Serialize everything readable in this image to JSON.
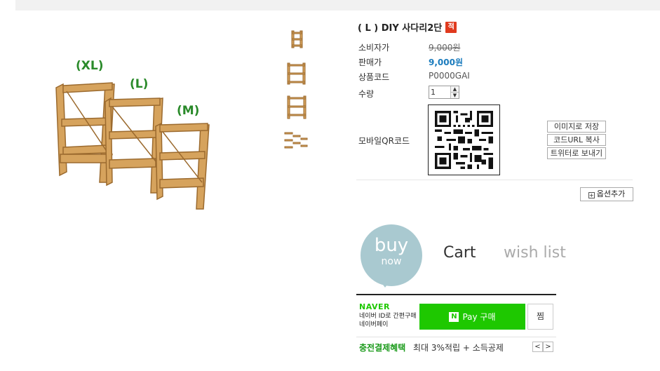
{
  "product": {
    "title": "( L ) DIY 사다리2단",
    "badge": "적",
    "size_labels": [
      "(XL)",
      "(L)",
      "(M)"
    ],
    "wood_color": "#c8924f"
  },
  "details": {
    "consumer_price_label": "소비자가",
    "consumer_price": "9,000원",
    "sale_price_label": "판매가",
    "sale_price": "9,000원",
    "code_label": "상품코드",
    "code": "P0000GAI",
    "qty_label": "수량",
    "qty_value": "1",
    "qr_label": "모바일QR코드"
  },
  "qr_actions": [
    "이미지로 저장",
    "코드URL 복사",
    "트위터로 보내기"
  ],
  "option_add": "옵션추가",
  "buy": {
    "buy_big": "buy",
    "buy_small": "now",
    "cart": "Cart",
    "wish": "wish list",
    "circle_color": "#a9c9d0"
  },
  "naver": {
    "logo": "NAVER",
    "desc": "네이버 ID로 간편구매 네이버페이",
    "pay_n": "N",
    "pay_label": "Pay 구매",
    "jjim": "찜",
    "brand_color": "#1ec800"
  },
  "promo": {
    "highlight": "충전결제혜택",
    "text": "최대 3%적립 + 소득공제",
    "prev": "<",
    "next": ">"
  }
}
